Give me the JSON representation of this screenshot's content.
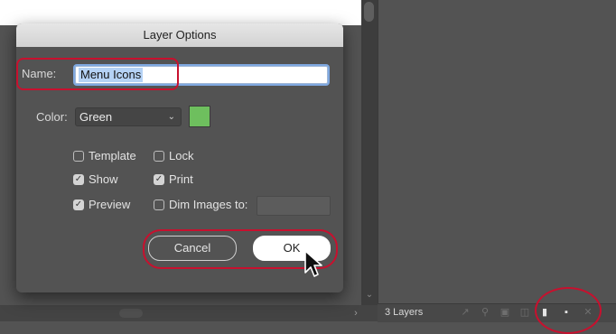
{
  "dialog": {
    "title": "Layer Options",
    "name_label": "Name:",
    "name_value": "Menu Icons",
    "color_label": "Color:",
    "color_value": "Green",
    "color_swatch_hex": "#6ebf5e",
    "checkboxes": [
      {
        "label": "Template",
        "checked": false
      },
      {
        "label": "Lock",
        "checked": false
      },
      {
        "label": "Show",
        "checked": true
      },
      {
        "label": "Print",
        "checked": true
      },
      {
        "label": "Preview",
        "checked": true
      },
      {
        "label": "Dim Images to:",
        "checked": false
      }
    ],
    "cancel_label": "Cancel",
    "ok_label": "OK"
  },
  "layers_panel": {
    "count_label": "3 Layers"
  },
  "accent_colors": {
    "highlight": "#c8102e",
    "focus_ring": "#7fa8e0"
  }
}
